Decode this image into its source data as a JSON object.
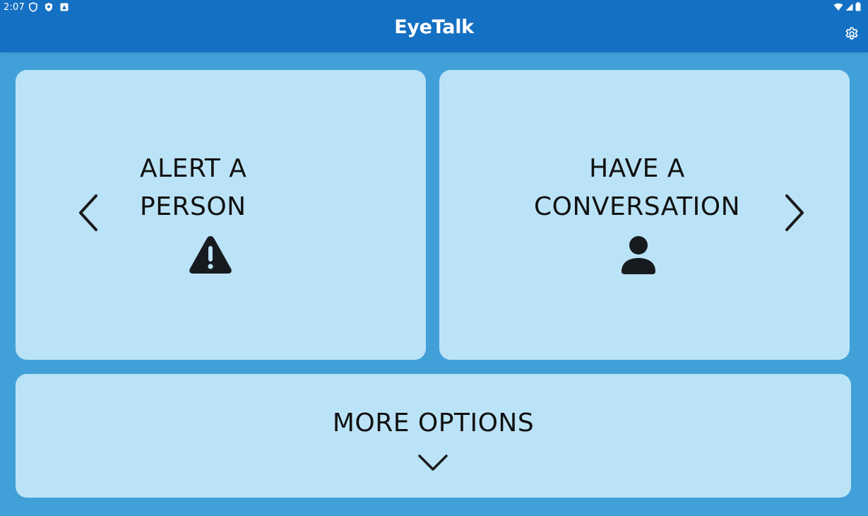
{
  "status_bar": {
    "time": "2:07",
    "left_icons": [
      "shield-outline-icon",
      "shield-filled-icon",
      "app-notification-icon"
    ],
    "right_icons": [
      "wifi-icon",
      "cell-signal-icon",
      "battery-icon"
    ]
  },
  "app_bar": {
    "title": "EyeTalk",
    "settings_icon": "gear-icon"
  },
  "cards": {
    "left": {
      "label": "ALERT A\nPERSON",
      "icon": "warning-icon",
      "nav_icon": "chevron-left-icon"
    },
    "right": {
      "label": "HAVE A\nCONVERSATION",
      "icon": "person-icon",
      "nav_icon": "chevron-right-icon"
    },
    "bottom": {
      "label": "MORE OPTIONS",
      "nav_icon": "chevron-down-icon"
    }
  },
  "colors": {
    "app_bar": "#1470c2",
    "background": "#42a0d8",
    "card": "#bbe3f7",
    "text": "#111111"
  }
}
